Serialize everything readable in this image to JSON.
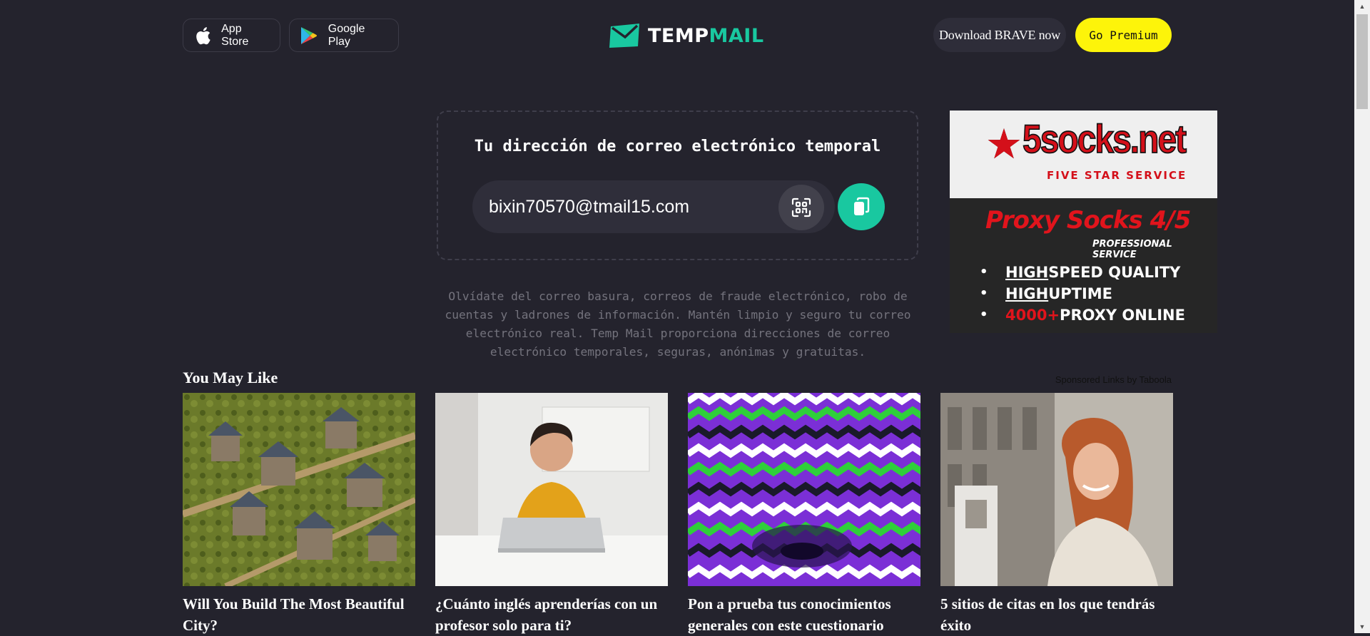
{
  "header": {
    "app_store_label": "App Store",
    "google_play_label": "Google Play",
    "logo_word_1": "TEMP",
    "logo_word_2": "MAIL",
    "brave_label": "Download BRAVE now",
    "premium_label": "Go Premium"
  },
  "mailbox": {
    "title": "Tu dirección de correo electrónico temporal",
    "email": "bixin70570@tmail15.com",
    "qr_icon": "qr-code-icon",
    "copy_icon": "copy-icon"
  },
  "description": "Olvídate del correo basura, correos de fraude electrónico, robo de cuentas y ladrones de información. Mantén limpio y seguro tu correo electrónico real. Temp Mail proporciona direcciones de correo electrónico temporales, seguras, anónimas y gratuitas.",
  "ad": {
    "brand_digit": "5",
    "brand_domain": "socks.net",
    "tagline": "FIVE STAR SERVICE",
    "headline": "Proxy Socks 4/5",
    "subheadline": "PROFESSIONAL SERVICE",
    "bullets": [
      {
        "a": "HIGH",
        "b": " SPEED QUALITY"
      },
      {
        "a": "HIGH",
        "b": " UPTIME"
      },
      {
        "a": "4000+",
        "b": " PROXY ONLINE"
      }
    ]
  },
  "recommendations": {
    "heading": "You May Like",
    "sponsored": "Sponsored Links by Taboola",
    "cards": [
      {
        "caption": "Will You Build The Most Beautiful City?"
      },
      {
        "caption": "¿Cuánto inglés aprenderías con un profesor solo para ti?"
      },
      {
        "caption": "Pon a prueba tus conocimientos generales con este cuestionario"
      },
      {
        "caption": "5 sitios de citas en los que tendrás éxito"
      }
    ]
  },
  "colors": {
    "background": "#24232d",
    "accent": "#19c8a0",
    "premium": "#fdf40a"
  }
}
